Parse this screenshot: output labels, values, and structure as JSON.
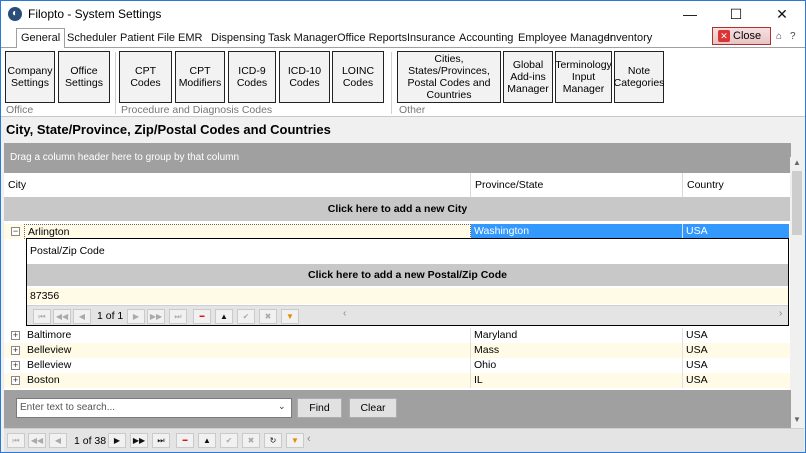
{
  "window": {
    "title": "Filopto - System Settings"
  },
  "tabs": [
    "General",
    "Scheduler",
    "Patient File",
    "EMR",
    "Dispensing",
    "Task Manager",
    "Office Reports",
    "Insurance",
    "Accounting",
    "Employee Manager",
    "Inventory"
  ],
  "close_label": "Close",
  "ribbon": {
    "office": [
      "Company Settings",
      "Office Settings"
    ],
    "procedure": [
      "CPT Codes",
      "CPT Modifiers",
      "ICD-9 Codes",
      "ICD-10 Codes",
      "LOINC Codes"
    ],
    "other": [
      "Cities, States/Provinces, Postal Codes and Countries",
      "Global Add-ins Manager",
      "Terminology Input Manager",
      "Note Categories"
    ],
    "groups": [
      "Office",
      "Procedure and Diagnosis Codes",
      "Other"
    ]
  },
  "section_title": "City, State/Province, Zip/Postal Codes and Countries",
  "grid": {
    "group_hint": "Drag a column header here to group by that column",
    "columns": [
      "City",
      "Province/State",
      "Country"
    ],
    "add_city": "Click here to add a new City",
    "expanded": {
      "city": "Arlington",
      "state": "Washington",
      "country": "USA"
    },
    "detail": {
      "header": "Postal/Zip Code",
      "add_postal": "Click here to add a new Postal/Zip Code",
      "codes": [
        "87356"
      ],
      "pager": "1 of 1"
    },
    "rows": [
      {
        "city": "Baltimore",
        "state": "Maryland",
        "country": "USA"
      },
      {
        "city": "Belleview",
        "state": "Mass",
        "country": "USA"
      },
      {
        "city": "Belleview",
        "state": "Ohio",
        "country": "USA"
      },
      {
        "city": "Boston",
        "state": "IL",
        "country": "USA"
      }
    ],
    "pager": "1 of 38"
  },
  "search": {
    "placeholder": "Enter text to search...",
    "find": "Find",
    "clear": "Clear"
  },
  "colors": {
    "selection": "#3399ff",
    "row_highlight": "#fffbe6"
  }
}
